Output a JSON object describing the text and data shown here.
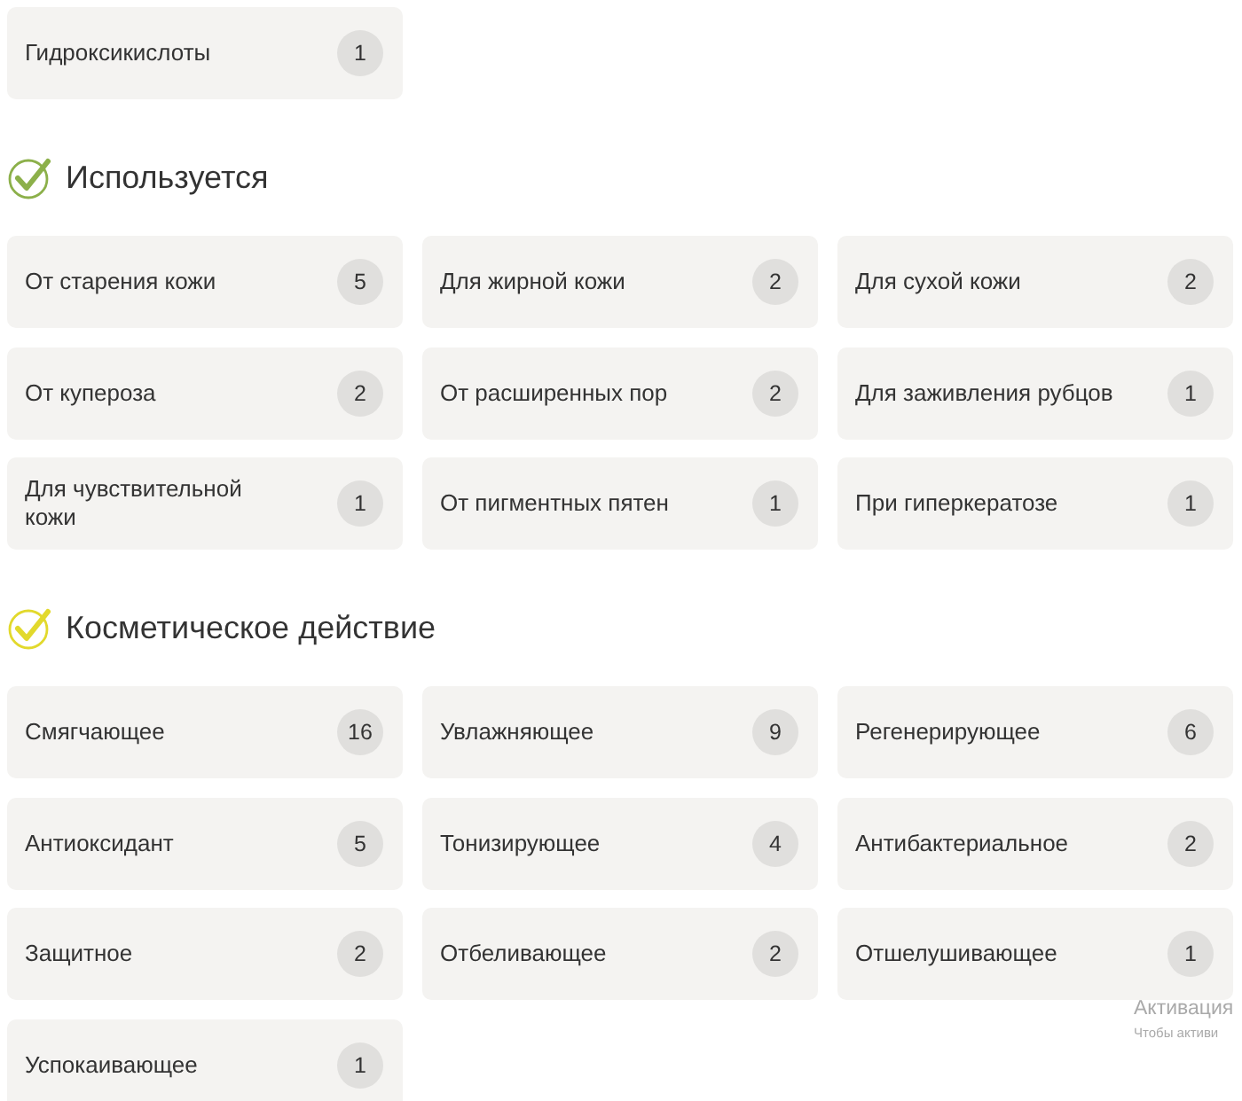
{
  "top_items": [
    {
      "label": "Гидроксикислоты",
      "count": "1"
    }
  ],
  "sections": [
    {
      "title": "Используется",
      "color": "#8cb04a",
      "items": [
        {
          "label": "От старения кожи",
          "count": "5"
        },
        {
          "label": "Для жирной кожи",
          "count": "2"
        },
        {
          "label": "Для сухой кожи",
          "count": "2"
        },
        {
          "label": "От купероза",
          "count": "2"
        },
        {
          "label": "От расширенных пор",
          "count": "2"
        },
        {
          "label": "Для заживления рубцов",
          "count": "1"
        },
        {
          "label": "Для чувствительной кожи",
          "count": "1"
        },
        {
          "label": "От пигментных пятен",
          "count": "1"
        },
        {
          "label": "При гиперкератозе",
          "count": "1"
        }
      ]
    },
    {
      "title": "Косметическое действие",
      "color": "#e2d92c",
      "items": [
        {
          "label": "Смягчающее",
          "count": "16"
        },
        {
          "label": "Увлажняющее",
          "count": "9"
        },
        {
          "label": "Регенерирующее",
          "count": "6"
        },
        {
          "label": "Антиоксидант",
          "count": "5"
        },
        {
          "label": "Тонизирующее",
          "count": "4"
        },
        {
          "label": "Антибактериальное",
          "count": "2"
        },
        {
          "label": "Защитное",
          "count": "2"
        },
        {
          "label": "Отбеливающее",
          "count": "2"
        },
        {
          "label": "Отшелушивающее",
          "count": "1"
        },
        {
          "label": "Успокаивающее",
          "count": "1"
        }
      ]
    }
  ],
  "activation_notice": {
    "title": "Активация",
    "subtitle": "Чтобы активи"
  }
}
